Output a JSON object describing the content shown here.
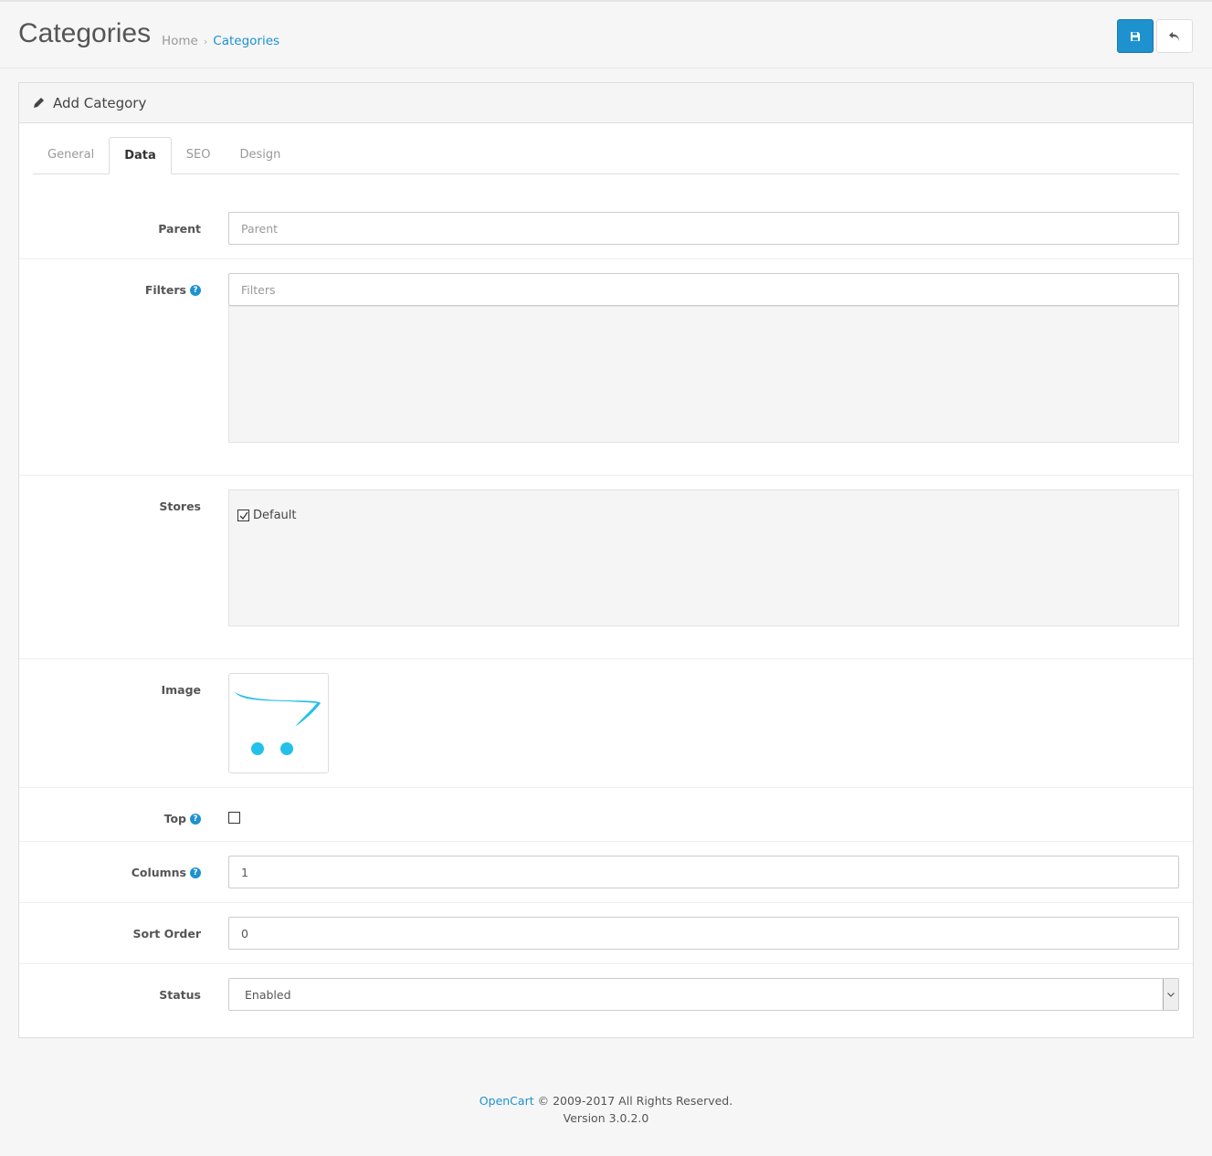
{
  "header": {
    "title": "Categories",
    "breadcrumb": [
      {
        "label": "Home"
      },
      {
        "label": "Categories"
      }
    ],
    "save_icon": "floppy-disk-icon",
    "back_icon": "reply-icon"
  },
  "panel": {
    "title": "Add Category",
    "title_icon": "pencil-icon",
    "tabs": [
      {
        "label": "General"
      },
      {
        "label": "Data",
        "active": true
      },
      {
        "label": "SEO"
      },
      {
        "label": "Design"
      }
    ],
    "fields": {
      "parent": {
        "label": "Parent",
        "placeholder": "Parent",
        "value": ""
      },
      "filters": {
        "label": "Filters",
        "placeholder": "Filters",
        "value": ""
      },
      "stores": {
        "label": "Stores",
        "options": [
          {
            "label": "Default",
            "checked": true
          }
        ]
      },
      "image": {
        "label": "Image"
      },
      "top": {
        "label": "Top",
        "checked": false
      },
      "columns": {
        "label": "Columns",
        "value": "1"
      },
      "sort_order": {
        "label": "Sort Order",
        "value": "0"
      },
      "status": {
        "label": "Status",
        "value": "Enabled"
      }
    }
  },
  "footer": {
    "link": "OpenCart",
    "text": " © 2009-2017 All Rights Reserved.",
    "version": "Version 3.0.2.0"
  },
  "colors": {
    "primary": "#1e91cf",
    "logo": "#23c0ec"
  }
}
